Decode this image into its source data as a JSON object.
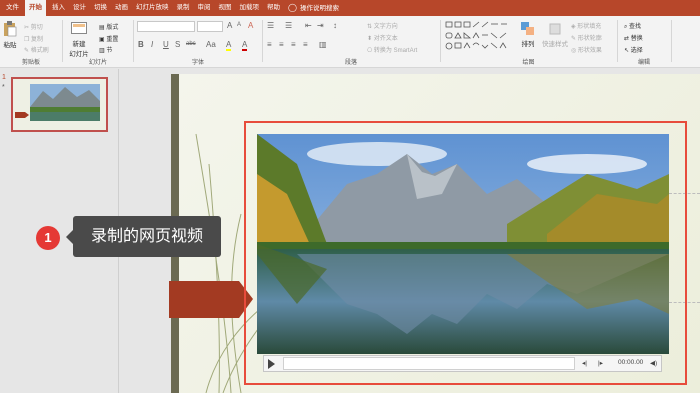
{
  "tabs": [
    {
      "label": "文件",
      "active": false
    },
    {
      "label": "开始",
      "active": true
    },
    {
      "label": "插入",
      "active": false
    },
    {
      "label": "设计",
      "active": false
    },
    {
      "label": "切换",
      "active": false
    },
    {
      "label": "动画",
      "active": false
    },
    {
      "label": "幻灯片放映",
      "active": false
    },
    {
      "label": "录制",
      "active": false
    },
    {
      "label": "审阅",
      "active": false
    },
    {
      "label": "视图",
      "active": false
    },
    {
      "label": "加载项",
      "active": false
    },
    {
      "label": "帮助",
      "active": false
    }
  ],
  "tell_me": "操作说明搜索",
  "ribbon": {
    "clipboard": {
      "paste": "粘贴",
      "cut": "剪切",
      "copy": "复制",
      "format_painter": "格式刷",
      "label": "剪贴板"
    },
    "slides": {
      "new_slide_line1": "新建",
      "new_slide_line2": "幻灯片",
      "layout": "版式",
      "reset": "重置",
      "section": "节",
      "label": "幻灯片"
    },
    "font": {
      "bold": "B",
      "italic": "I",
      "underline": "U",
      "shadow": "S",
      "strike": "abc",
      "grow": "A",
      "shrink": "A",
      "clear": "A",
      "case": "Aa",
      "color": "A",
      "highlight": "A",
      "label": "字体"
    },
    "paragraph": {
      "text_direction": "文字方向",
      "align_text": "对齐文本",
      "smartart": "转换为 SmartArt",
      "label": "段落"
    },
    "drawing": {
      "arrange": "排列",
      "quick_styles": "快速样式",
      "shape_fill": "形状填充",
      "shape_outline": "形状轮廓",
      "shape_effects": "形状效果",
      "label": "绘图"
    },
    "editing": {
      "find": "查找",
      "replace": "替换",
      "select": "选择",
      "label": "编辑"
    }
  },
  "slide_panel": {
    "number": "1",
    "star": "*"
  },
  "player": {
    "time": "00:00.00"
  },
  "callout": {
    "badge": "1",
    "text": "录制的网页视频"
  },
  "colors": {
    "accent": "#b7472a",
    "frame": "#e74c3c",
    "badge": "#e53935",
    "tooltip": "#4a4a4a"
  },
  "icons": {
    "tell_me": "lightbulb-icon",
    "play": "play-icon",
    "volume": "volume-icon"
  }
}
